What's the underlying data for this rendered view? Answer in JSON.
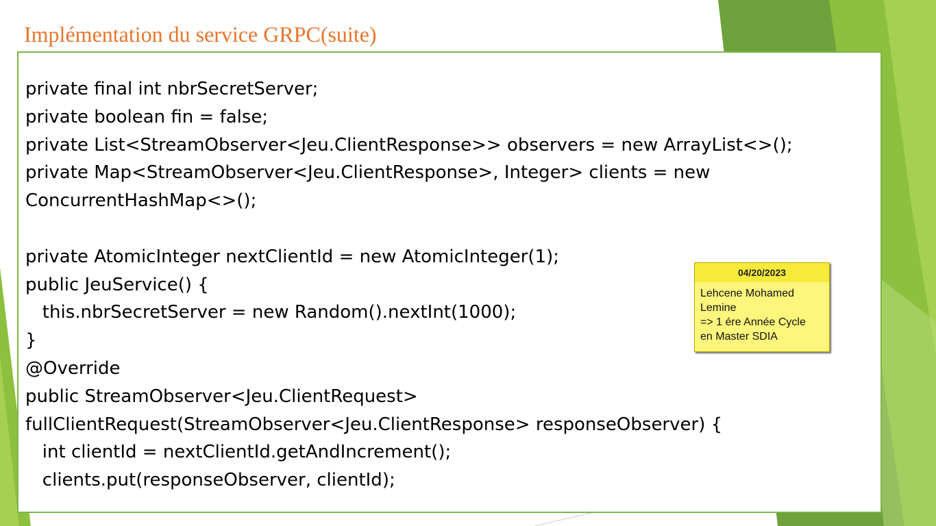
{
  "slide": {
    "title": "Implémentation du service GRPC(suite)",
    "colors": {
      "title": "#e8762d",
      "box_border": "#7ab648",
      "accent_green_dark": "#5f9a36",
      "accent_green_light": "#9cc94a",
      "note_background": "#fdf57c"
    }
  },
  "code": {
    "lines": [
      "private final int nbrSecretServer;",
      "private boolean fin = false;",
      "private List<StreamObserver<Jeu.ClientResponse>> observers = new ArrayList<>();",
      "private Map<StreamObserver<Jeu.ClientResponse>, Integer> clients = new",
      "ConcurrentHashMap<>();",
      "",
      "private AtomicInteger nextClientId = new AtomicInteger(1);",
      "public JeuService() {",
      "   this.nbrSecretServer = new Random().nextInt(1000);",
      "}",
      "@Override",
      "public StreamObserver<Jeu.ClientRequest>",
      "fullClientRequest(StreamObserver<Jeu.ClientResponse> responseObserver) {",
      "   int clientId = nextClientId.getAndIncrement();",
      "   clients.put(responseObserver, clientId);"
    ]
  },
  "note": {
    "date": "04/20/2023",
    "lines": [
      "Lehcene Mohamed",
      "Lemine",
      "=> 1 ére Année Cycle",
      "en Master SDIA"
    ]
  }
}
